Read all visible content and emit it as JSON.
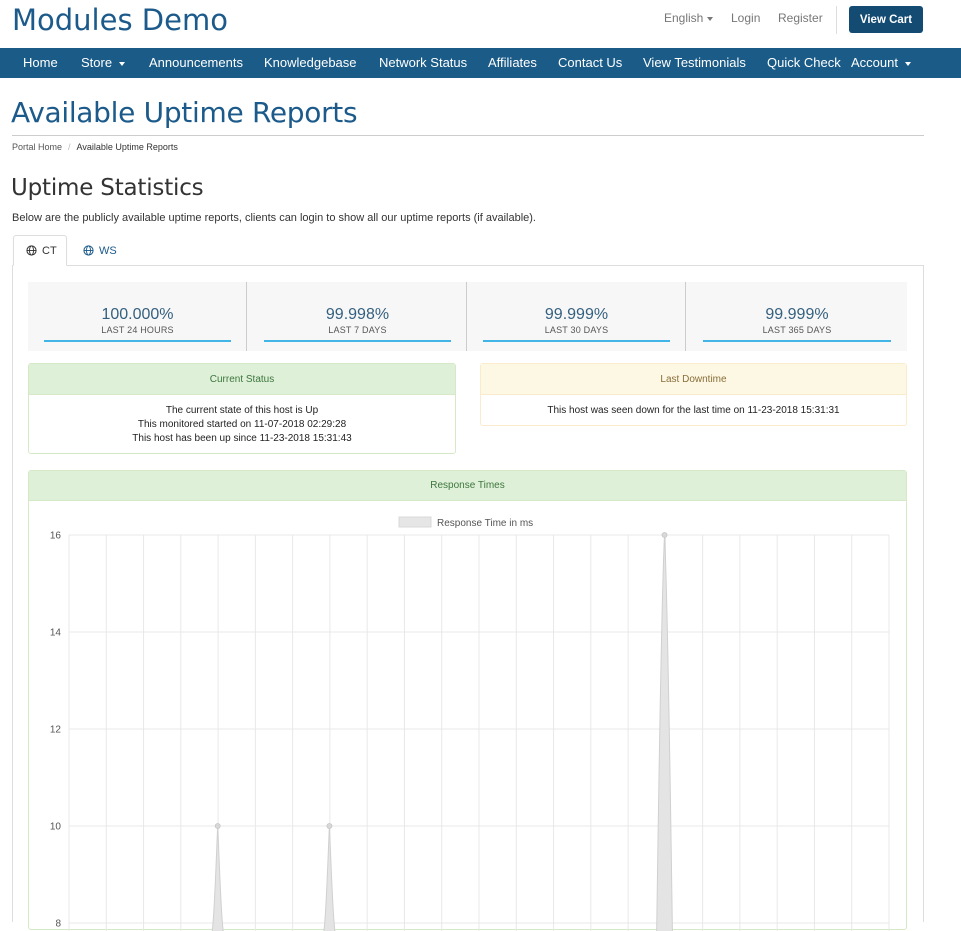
{
  "header": {
    "brand": "Modules Demo",
    "language": "English",
    "login": "Login",
    "register": "Register",
    "view_cart": "View Cart"
  },
  "nav": {
    "items": [
      {
        "label": "Home"
      },
      {
        "label": "Store"
      },
      {
        "label": "Announcements"
      },
      {
        "label": "Knowledgebase"
      },
      {
        "label": "Network Status"
      },
      {
        "label": "Affiliates"
      },
      {
        "label": "Contact Us"
      },
      {
        "label": "View Testimonials"
      },
      {
        "label": "Quick Check"
      },
      {
        "label": "Account"
      }
    ]
  },
  "page": {
    "title": "Available Uptime Reports",
    "breadcrumb": [
      "Portal Home",
      "Available Uptime Reports"
    ],
    "section_title": "Uptime Statistics",
    "intro": "Below are the publicly available uptime reports, clients can login to show all our uptime reports (if available)."
  },
  "tabs": [
    {
      "label": "CT",
      "active": true
    },
    {
      "label": "WS",
      "active": false
    }
  ],
  "stats": [
    {
      "value": "100.000%",
      "label": "LAST 24 HOURS"
    },
    {
      "value": "99.998%",
      "label": "LAST 7 DAYS"
    },
    {
      "value": "99.999%",
      "label": "LAST 30 DAYS"
    },
    {
      "value": "99.999%",
      "label": "LAST 365 DAYS"
    }
  ],
  "current_status": {
    "heading": "Current Status",
    "line1": "The current state of this host is Up",
    "line2": "This monitored started on 11-07-2018 02:29:28",
    "line3": "This host has been up since 11-23-2018 15:31:43"
  },
  "last_downtime": {
    "heading": "Last Downtime",
    "line1": "This host was seen down for the last time on 11-23-2018 15:31:31"
  },
  "colors": {
    "brand": "#1b5a8a",
    "navbar": "#1a5b87",
    "accent_bar": "#41b6e6",
    "success_bg": "#dff0d8",
    "warning_bg": "#fcf8e3"
  },
  "chart_data": {
    "type": "area",
    "title": "Response Times",
    "legend": [
      "Response Time in ms"
    ],
    "legend_position": "top",
    "grid": true,
    "ylim": [
      8,
      16
    ],
    "yticks": [
      8,
      10,
      12,
      14,
      16
    ],
    "series": [
      {
        "name": "Response Time in ms",
        "values": [
          0,
          0,
          0,
          10,
          0,
          0,
          10,
          0,
          0,
          0,
          0,
          0,
          0,
          0,
          0,
          16,
          0,
          0,
          0,
          0,
          0,
          0,
          0
        ]
      }
    ]
  }
}
